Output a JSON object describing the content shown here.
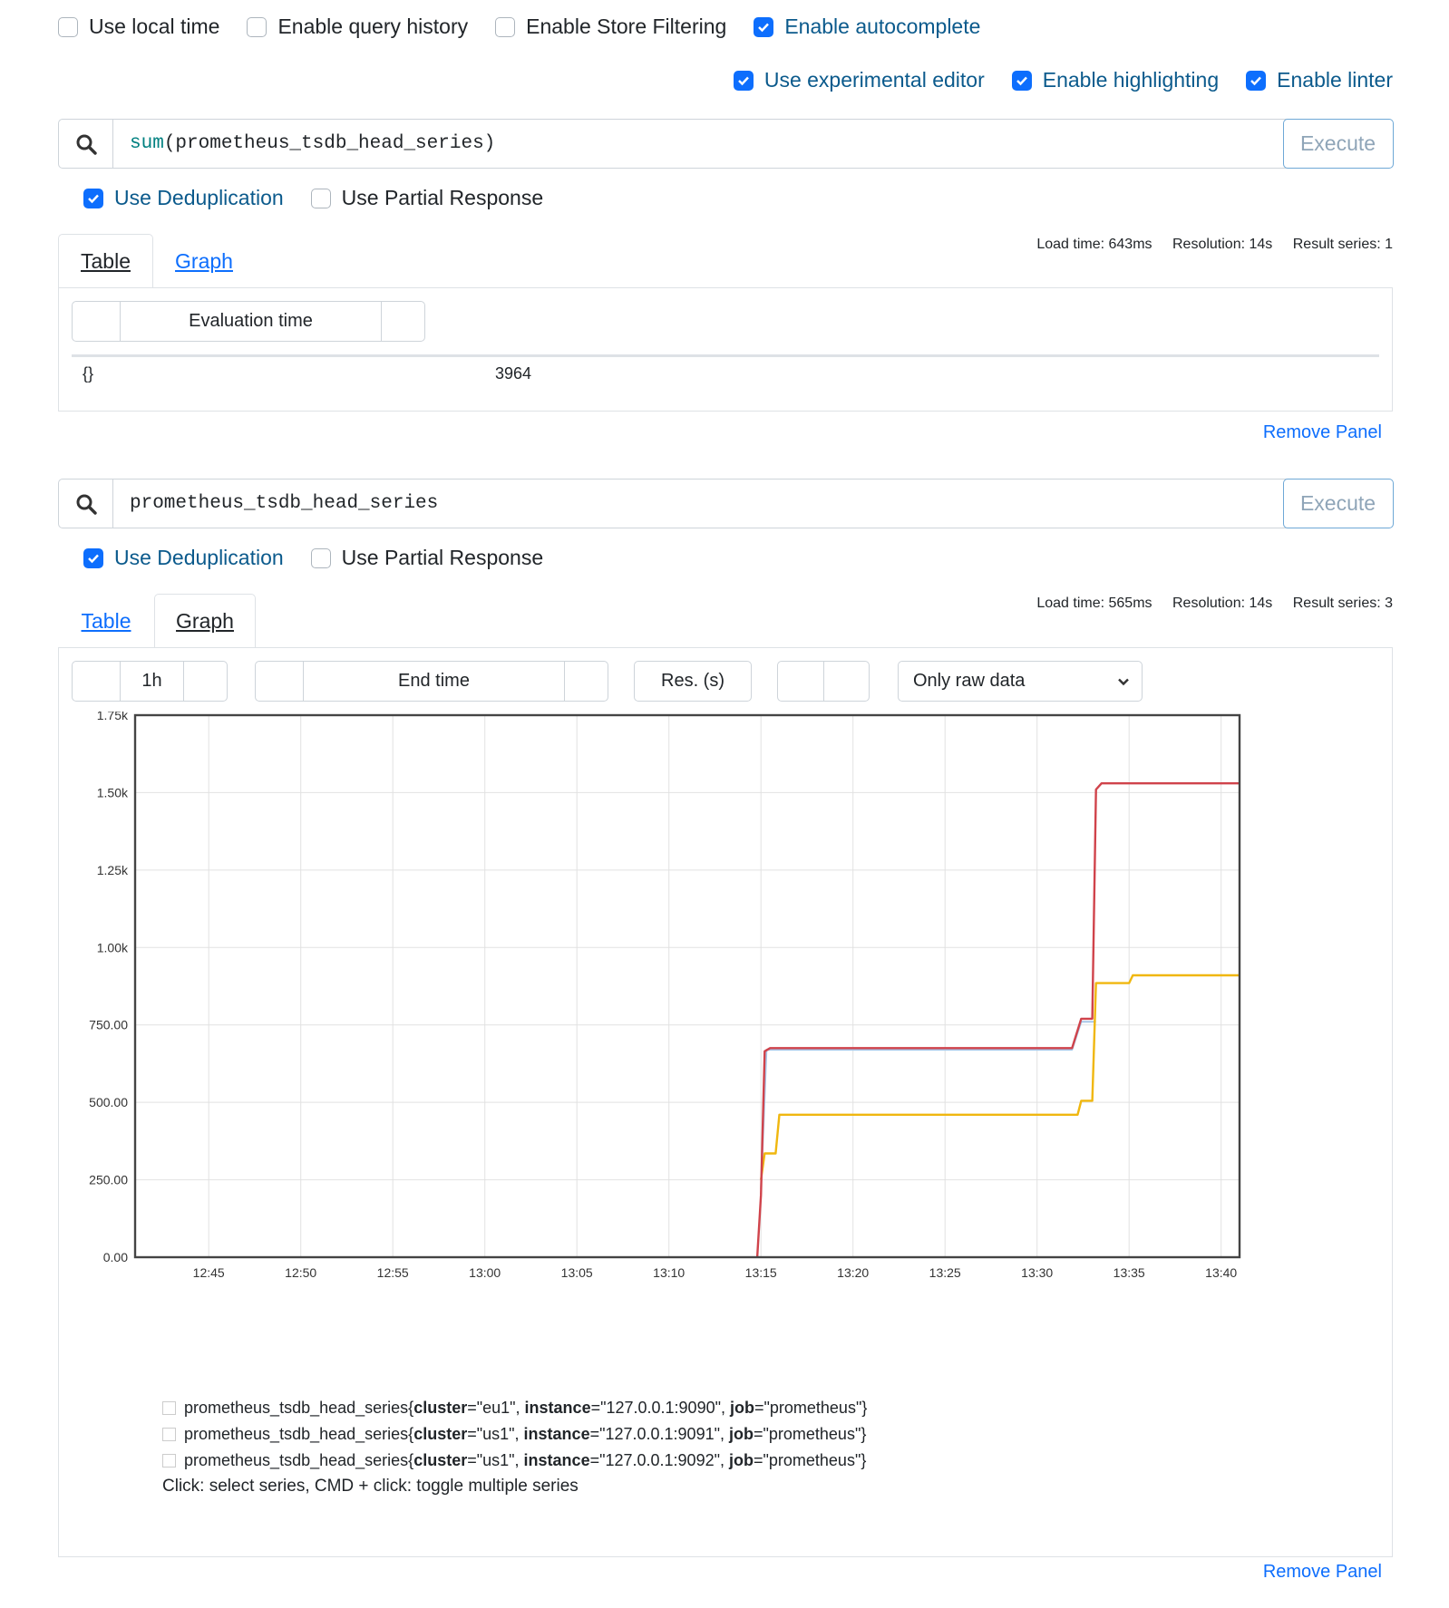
{
  "settings_row1": [
    {
      "label": "Use local time",
      "checked": false
    },
    {
      "label": "Enable query history",
      "checked": false
    },
    {
      "label": "Enable Store Filtering",
      "checked": false
    },
    {
      "label": "Enable autocomplete",
      "checked": true
    }
  ],
  "settings_row2": [
    {
      "label": "Use experimental editor",
      "checked": true
    },
    {
      "label": "Enable highlighting",
      "checked": true
    },
    {
      "label": "Enable linter",
      "checked": true
    }
  ],
  "panel1": {
    "query_fn": "sum",
    "query_rest": "(prometheus_tsdb_head_series)",
    "execute": "Execute",
    "dedup": "Use Deduplication",
    "partial": "Use Partial Response",
    "stats": {
      "load": "Load time: 643ms",
      "resolution": "Resolution: 14s",
      "series": "Result series: 1"
    },
    "tabs": [
      "Table",
      "Graph"
    ],
    "eval_time": "Evaluation time",
    "result_labels": "{}",
    "result_value": "3964",
    "remove": "Remove Panel"
  },
  "panel2": {
    "query": "prometheus_tsdb_head_series",
    "execute": "Execute",
    "dedup": "Use Deduplication",
    "partial": "Use Partial Response",
    "stats": {
      "load": "Load time: 565ms",
      "resolution": "Resolution: 14s",
      "series": "Result series: 3"
    },
    "tabs": [
      "Table",
      "Graph"
    ],
    "range": "1h",
    "end_time": "End time",
    "res": "Res. (s)",
    "downsample": "Only raw data",
    "legend": [
      {
        "metric": "prometheus_tsdb_head_series",
        "cluster": "eu1",
        "instance": "127.0.0.1:9090",
        "job": "prometheus"
      },
      {
        "metric": "prometheus_tsdb_head_series",
        "cluster": "us1",
        "instance": "127.0.0.1:9091",
        "job": "prometheus"
      },
      {
        "metric": "prometheus_tsdb_head_series",
        "cluster": "us1",
        "instance": "127.0.0.1:9092",
        "job": "prometheus"
      }
    ],
    "hint": "Click: select series, CMD + click: toggle multiple series",
    "remove": "Remove Panel"
  },
  "colors": {
    "accent": "#0d6efd",
    "series_red": "#d0434b",
    "series_yellow": "#f0b70f",
    "series_blue": "#a6c6e8"
  },
  "chart_data": {
    "type": "line",
    "title": "",
    "xlabel": "",
    "ylabel": "",
    "ylim": [
      0,
      1750
    ],
    "yticks": [
      "0.00",
      "250.00",
      "500.00",
      "750.00",
      "1.00k",
      "1.25k",
      "1.50k",
      "1.75k"
    ],
    "xticks": [
      "12:45",
      "12:50",
      "12:55",
      "13:00",
      "13:05",
      "13:10",
      "13:15",
      "13:20",
      "13:25",
      "13:30",
      "13:35",
      "13:40"
    ],
    "xlim": [
      "12:41",
      "13:41"
    ],
    "grid": true,
    "series": [
      {
        "name": "",
        "color": "#d0434b",
        "x": [
          "13:14.8",
          "13:15.0",
          "13:15.2",
          "13:15.5",
          "13:31.9",
          "13:32.4",
          "13:33.0",
          "13:33.2",
          "13:33.5",
          "13:41.0"
        ],
        "y": [
          0,
          200,
          665,
          675,
          675,
          770,
          770,
          1510,
          1530,
          1530
        ]
      },
      {
        "name": "",
        "color": "#f0b70f",
        "x": [
          "13:15.0",
          "13:15.2",
          "13:15.8",
          "13:16.0",
          "13:32.2",
          "13:32.4",
          "13:33.0",
          "13:33.2",
          "13:35.0",
          "13:35.2",
          "13:41.0"
        ],
        "y": [
          250,
          335,
          335,
          460,
          460,
          505,
          505,
          885,
          885,
          910,
          910
        ]
      },
      {
        "name": "",
        "color": "#a6c6e8",
        "x": [
          "13:15.0",
          "13:15.3",
          "13:15.6",
          "13:31.9",
          "13:32.4",
          "13:33.0",
          "13:33.2"
        ],
        "y": [
          220,
          670,
          670,
          670,
          760,
          760,
          760
        ]
      }
    ]
  }
}
